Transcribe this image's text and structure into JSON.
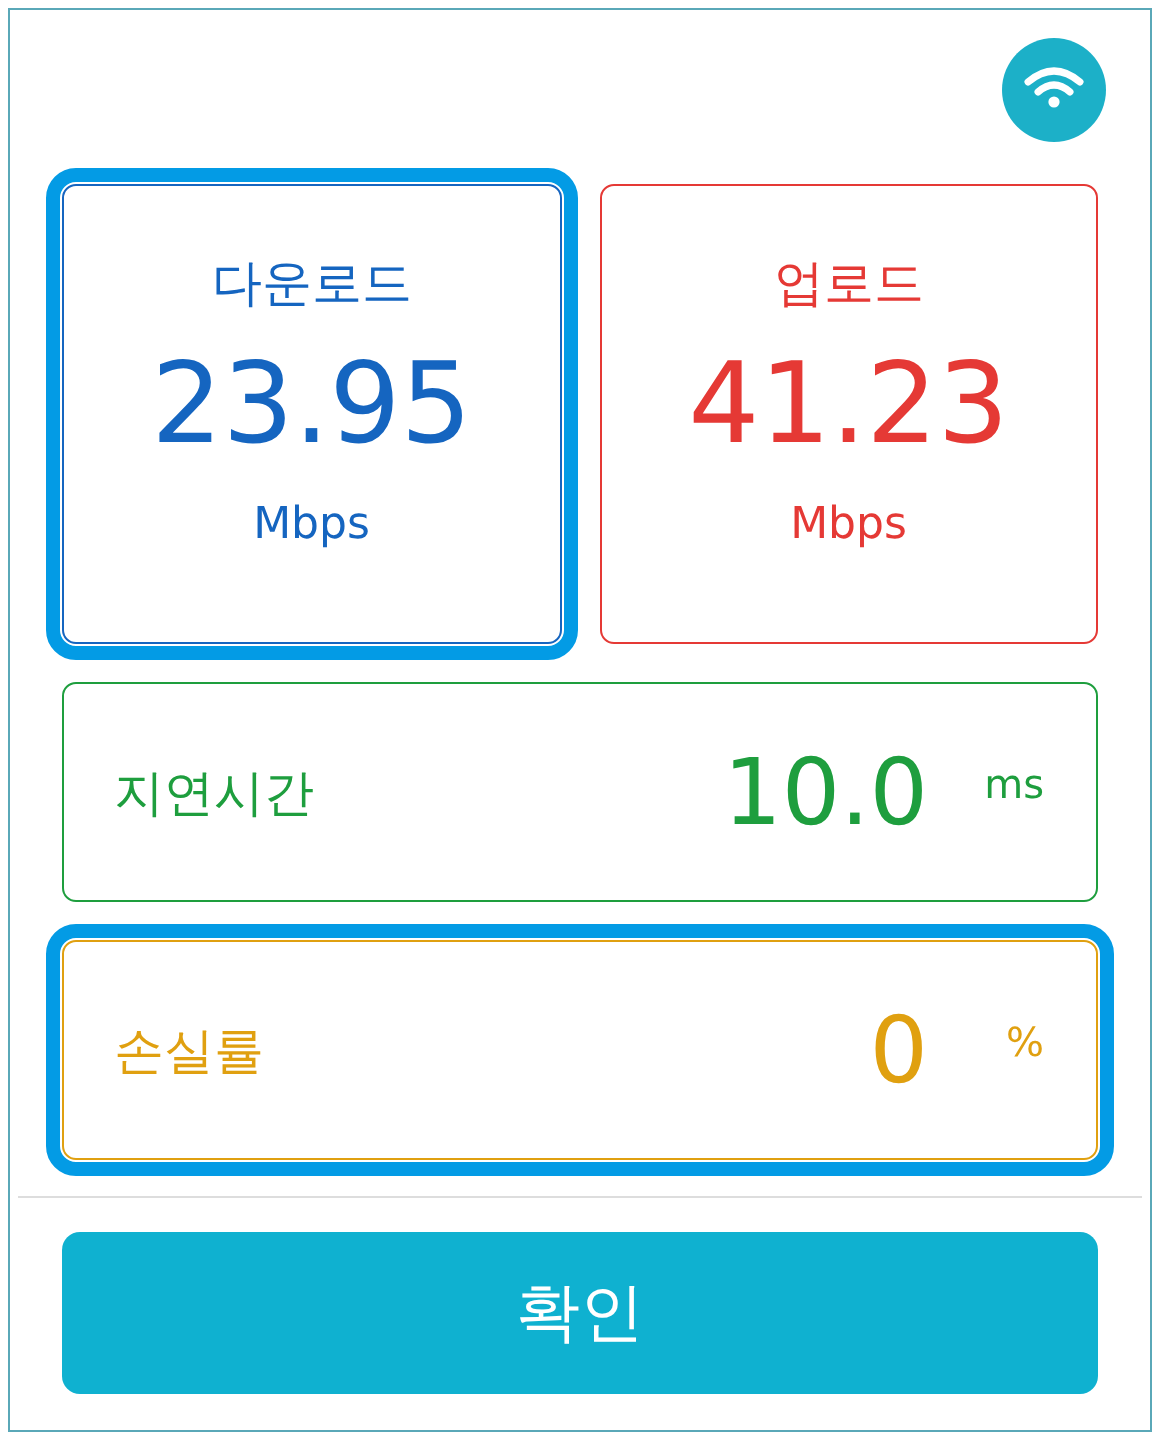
{
  "speed_cards": [
    {
      "label": "다운로드",
      "value": "23.95",
      "unit": "Mbps",
      "color": "#1565c0",
      "highlighted": true
    },
    {
      "label": "업로드",
      "value": "41.23",
      "unit": "Mbps",
      "color": "#e53935",
      "highlighted": false
    }
  ],
  "metric_rows": [
    {
      "label": "지연시간",
      "value": "10.0",
      "unit": "ms",
      "color": "#1e9e3e",
      "highlighted": false
    },
    {
      "label": "손실률",
      "value": "0",
      "unit": "%",
      "color": "#e0a010",
      "highlighted": true
    }
  ],
  "confirm_button": "확인"
}
